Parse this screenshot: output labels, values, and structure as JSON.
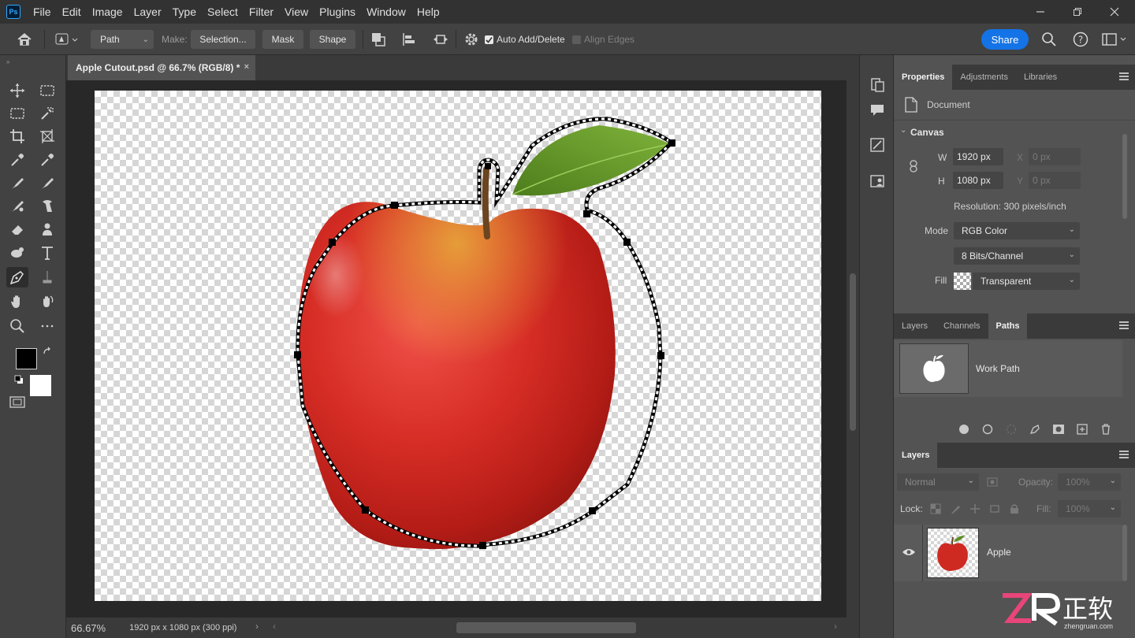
{
  "app": {
    "logo": "Ps"
  },
  "menu": [
    "File",
    "Edit",
    "Image",
    "Layer",
    "Type",
    "Select",
    "Filter",
    "View",
    "Plugins",
    "Window",
    "Help"
  ],
  "options": {
    "mode": "Path",
    "make_label": "Make:",
    "selection_btn": "Selection...",
    "mask_btn": "Mask",
    "shape_btn": "Shape",
    "auto_add_delete": "Auto Add/Delete",
    "align_edges": "Align Edges",
    "share_btn": "Share"
  },
  "document": {
    "tab_title": "Apple Cutout.psd @ 66.7% (RGB/8) *",
    "zoom": "66.67%",
    "dimensions": "1920 px x 1080 px (300 ppi)"
  },
  "properties": {
    "tabs": [
      "Properties",
      "Adjustments",
      "Libraries"
    ],
    "doc_label": "Document",
    "canvas_header": "Canvas",
    "w_label": "W",
    "w_value": "1920 px",
    "h_label": "H",
    "h_value": "1080 px",
    "x_label": "X",
    "x_value": "0 px",
    "y_label": "Y",
    "y_value": "0 px",
    "resolution": "Resolution: 300 pixels/inch",
    "mode_label": "Mode",
    "mode_value": "RGB Color",
    "bits_value": "8 Bits/Channel",
    "fill_label": "Fill",
    "fill_value": "Transparent"
  },
  "paths_panel": {
    "tabs": [
      "Layers",
      "Channels",
      "Paths"
    ],
    "work_path": "Work Path"
  },
  "layers_panel": {
    "tab": "Layers",
    "blend_mode": "Normal",
    "opacity_label": "Opacity:",
    "opacity_value": "100%",
    "lock_label": "Lock:",
    "fill_label": "Fill:",
    "fill_value": "100%",
    "layer_name": "Apple"
  },
  "watermark": {
    "brand_cn": "正软",
    "site": "zhengruan.com"
  },
  "colors": {
    "accent": "#1473e6",
    "panel": "#535353",
    "dark": "#323232"
  }
}
